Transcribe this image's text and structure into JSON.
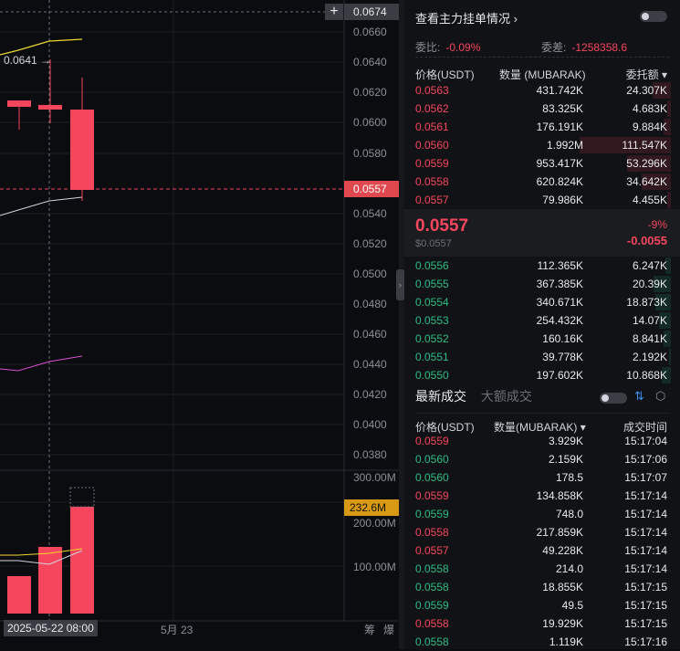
{
  "chart": {
    "price_ticks": [
      "0.0660",
      "0.0640",
      "0.0620",
      "0.0600",
      "0.0580",
      "0.0540",
      "0.0520",
      "0.0500",
      "0.0480",
      "0.0460",
      "0.0440",
      "0.0420",
      "0.0400",
      "0.0380"
    ],
    "top_price": "0.0674",
    "high_marker": "0.0641",
    "current_price_tag": "0.0557",
    "volume_ticks": [
      "300.00M",
      "200.00M",
      "100.00M"
    ],
    "volume_tag": "232.6M",
    "time_label_selected": "2025-05-22 08:00",
    "time_label_next": "5月 23",
    "footer_labels": [
      "筹",
      "爆"
    ],
    "colors": {
      "up": "#2ebd85",
      "down": "#f6465d",
      "accent": "#f0b90b"
    }
  },
  "orderbook": {
    "title": "查看主力挂单情况",
    "ratio_label": "委比:",
    "ratio_value": "-0.09%",
    "diff_label": "委差:",
    "diff_value": "-1258358.6",
    "col_price": "价格(USDT)",
    "col_qty": "数量 (MUBARAK)",
    "col_total": "委托额",
    "asks": [
      {
        "p": "0.0563",
        "q": "431.742K",
        "t": "24.307K",
        "depth": 0.2
      },
      {
        "p": "0.0562",
        "q": "83.325K",
        "t": "4.683K",
        "depth": 0.04
      },
      {
        "p": "0.0561",
        "q": "176.191K",
        "t": "9.884K",
        "depth": 0.08
      },
      {
        "p": "0.0560",
        "q": "1.992M",
        "t": "111.547K",
        "depth": 1.0
      },
      {
        "p": "0.0559",
        "q": "953.417K",
        "t": "53.296K",
        "depth": 0.48
      },
      {
        "p": "0.0558",
        "q": "620.824K",
        "t": "34.642K",
        "depth": 0.32
      },
      {
        "p": "0.0557",
        "q": "79.986K",
        "t": "4.455K",
        "depth": 0.04
      }
    ],
    "mid_price": "0.0557",
    "mid_sub": "$0.0557",
    "mid_change_pct": "-9%",
    "mid_change": "-0.0055",
    "bids": [
      {
        "p": "0.0556",
        "q": "112.365K",
        "t": "6.247K",
        "depth": 0.06
      },
      {
        "p": "0.0555",
        "q": "367.385K",
        "t": "20.39K",
        "depth": 0.19
      },
      {
        "p": "0.0554",
        "q": "340.671K",
        "t": "18.873K",
        "depth": 0.17
      },
      {
        "p": "0.0553",
        "q": "254.432K",
        "t": "14.07K",
        "depth": 0.13
      },
      {
        "p": "0.0552",
        "q": "160.16K",
        "t": "8.841K",
        "depth": 0.08
      },
      {
        "p": "0.0551",
        "q": "39.778K",
        "t": "2.192K",
        "depth": 0.02
      },
      {
        "p": "0.0550",
        "q": "197.602K",
        "t": "10.868K",
        "depth": 0.1
      }
    ]
  },
  "trades": {
    "tab_latest": "最新成交",
    "tab_large": "大额成交",
    "col_price": "价格(USDT)",
    "col_qty": "数量(MUBARAK)",
    "col_time": "成交时间",
    "rows": [
      {
        "p": "0.0559",
        "q": "3.929K",
        "t": "15:17:04",
        "side": "down"
      },
      {
        "p": "0.0560",
        "q": "2.159K",
        "t": "15:17:06",
        "side": "up"
      },
      {
        "p": "0.0560",
        "q": "178.5",
        "t": "15:17:07",
        "side": "up"
      },
      {
        "p": "0.0559",
        "q": "134.858K",
        "t": "15:17:14",
        "side": "down"
      },
      {
        "p": "0.0559",
        "q": "748.0",
        "t": "15:17:14",
        "side": "up"
      },
      {
        "p": "0.0558",
        "q": "217.859K",
        "t": "15:17:14",
        "side": "down"
      },
      {
        "p": "0.0557",
        "q": "49.228K",
        "t": "15:17:14",
        "side": "down"
      },
      {
        "p": "0.0558",
        "q": "214.0",
        "t": "15:17:14",
        "side": "up"
      },
      {
        "p": "0.0558",
        "q": "18.855K",
        "t": "15:17:15",
        "side": "up"
      },
      {
        "p": "0.0559",
        "q": "49.5",
        "t": "15:17:15",
        "side": "up"
      },
      {
        "p": "0.0558",
        "q": "19.929K",
        "t": "15:17:15",
        "side": "down"
      },
      {
        "p": "0.0558",
        "q": "1.119K",
        "t": "15:17:16",
        "side": "up"
      }
    ]
  }
}
